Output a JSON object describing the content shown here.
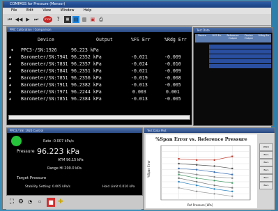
{
  "app": {
    "title": "COMPASS for Pressure (Mensor)",
    "menu": [
      "File",
      "Edit",
      "View",
      "Window",
      "Help"
    ]
  },
  "toolbar": {
    "stop_label": "STOP"
  },
  "data_window": {
    "title": "PMC Calibration / Comparison",
    "headers": [
      "Device",
      "Output",
      "%FS Err",
      "%Rdg Err"
    ],
    "rows": [
      {
        "device": "PPC3-/SN:1926",
        "output": "96.223 kPa",
        "fs_err": "",
        "rdg_err": ""
      },
      {
        "device": "Barometer/SN:7941",
        "output": "96.2352 kPa",
        "fs_err": "-0.021",
        "rdg_err": "-0.009"
      },
      {
        "device": "Barometer/SN:7831",
        "output": "96.2357 kPa",
        "fs_err": "-0.024",
        "rdg_err": "-0.010"
      },
      {
        "device": "Barometer/SN:7841",
        "output": "96.2351 kPa",
        "fs_err": "-0.021",
        "rdg_err": "-0.009"
      },
      {
        "device": "Barometer/SN:7851",
        "output": "96.2356 kPa",
        "fs_err": "-0.019",
        "rdg_err": "-0.008"
      },
      {
        "device": "Barometer/SN:7911",
        "output": "96.2382 kPa",
        "fs_err": "-0.013",
        "rdg_err": "-0.005"
      },
      {
        "device": "Barometer/SN:7971",
        "output": "96.2244 kPa",
        "fs_err": "0.003",
        "rdg_err": "0.001"
      },
      {
        "device": "Barometer/SN:7851",
        "output": "96.2384 kPa",
        "fs_err": "-0.013",
        "rdg_err": "-0.005"
      }
    ]
  },
  "table_window": {
    "title": "Test Data",
    "headers": [
      "Device",
      "%FS Err",
      "Reference Output",
      "Device Output",
      "%Rdg Err"
    ],
    "rows": [
      [
        "",
        "",
        "",
        "",
        ""
      ],
      [
        "",
        "",
        "",
        "",
        ""
      ],
      [
        "",
        "",
        "",
        "",
        ""
      ],
      [
        "",
        "",
        "",
        "",
        ""
      ],
      [
        "",
        "",
        "",
        "",
        ""
      ]
    ]
  },
  "pressure_window": {
    "title": "PPC3 / SN: 1926 Control",
    "rate": "Rate -0.007 kPa/s",
    "pressure_label": "Pressure",
    "pressure_value": "96.223 kPa",
    "atm": "ATM 96.15 kPa",
    "range": "Range HI 200.0 kPa",
    "target_label": "Target Pressure",
    "stability": "Stability Setting: 0.005 kPa/s",
    "hold_limit": "Hold Limit 0.010 kPa"
  },
  "chart_window": {
    "title": "Test Data Plot"
  },
  "chart_data": {
    "type": "line",
    "title": "%Span Error vs. Reference Pressure",
    "xlabel": "Ref Pressure [kPa]",
    "ylabel": "%Span Error",
    "x": [
      95.95,
      96.0,
      96.05,
      96.1
    ],
    "xlim": [
      95.9,
      96.15
    ],
    "ylim": [
      -0.04,
      0.005
    ],
    "series": [
      {
        "values": [
          -0.006,
          -0.007,
          -0.007,
          -0.004
        ],
        "color": "#c0392b"
      },
      {
        "values": [
          -0.01,
          -0.011,
          -0.012,
          -0.014
        ],
        "color": "#555555"
      },
      {
        "values": [
          -0.014,
          -0.015,
          -0.017,
          -0.019
        ],
        "color": "#3a6fb3"
      },
      {
        "values": [
          -0.017,
          -0.019,
          -0.021,
          -0.022
        ],
        "color": "#888888"
      },
      {
        "values": [
          -0.019,
          -0.022,
          -0.024,
          -0.026
        ],
        "color": "#4a9b6a"
      },
      {
        "values": [
          -0.022,
          -0.025,
          -0.028,
          -0.03
        ],
        "color": "#777777"
      },
      {
        "values": [
          -0.025,
          -0.028,
          -0.031,
          -0.033
        ],
        "color": "#2e86c1"
      },
      {
        "values": [
          -0.03,
          -0.033,
          -0.035,
          -0.037
        ],
        "color": "#999999"
      }
    ],
    "grid": true,
    "legend_items": [
      "PPC3",
      "Baro",
      "Baro",
      "Baro",
      "Baro",
      "Baro"
    ]
  }
}
